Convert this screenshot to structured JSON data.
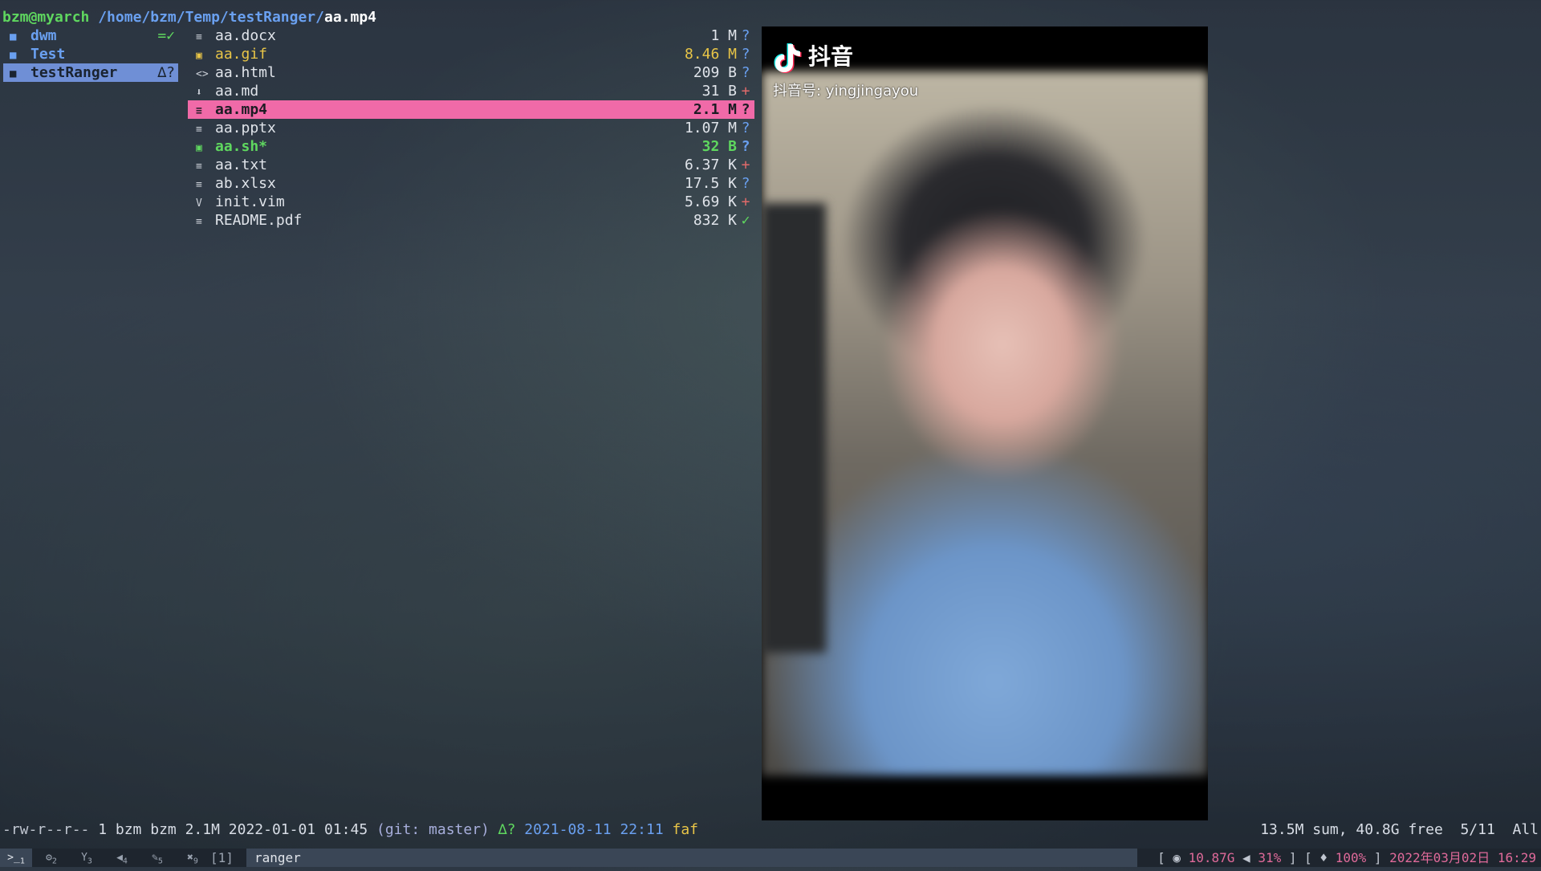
{
  "title": {
    "user": "bzm@myarch",
    "path": "/home/bzm/Temp/testRanger/",
    "file": "aa.mp4"
  },
  "parent": [
    {
      "name": "dwm",
      "tag": "=✓"
    },
    {
      "name": "Test",
      "tag": ""
    },
    {
      "name": "testRanger",
      "tag": "∆?"
    }
  ],
  "files": [
    {
      "icon": "doc-icon",
      "glyph": "≡",
      "name": "aa.docx",
      "size": "1 M",
      "status": "?"
    },
    {
      "icon": "image-icon",
      "glyph": "▣",
      "name": "aa.gif",
      "size": "8.46 M",
      "status": "?"
    },
    {
      "icon": "code-icon",
      "glyph": "<>",
      "name": "aa.html",
      "size": "209 B",
      "status": "?"
    },
    {
      "icon": "markdown-icon",
      "glyph": "⬇",
      "name": "aa.md",
      "size": "31 B",
      "status": "+"
    },
    {
      "icon": "doc-icon",
      "glyph": "≡",
      "name": "aa.mp4",
      "size": "2.1 M",
      "status": "?"
    },
    {
      "icon": "doc-icon",
      "glyph": "≡",
      "name": "aa.pptx",
      "size": "1.07 M",
      "status": "?"
    },
    {
      "icon": "terminal-icon",
      "glyph": "▣",
      "name": "aa.sh*",
      "size": "32 B",
      "status": "?"
    },
    {
      "icon": "doc-icon",
      "glyph": "≡",
      "name": "aa.txt",
      "size": "6.37 K",
      "status": "+"
    },
    {
      "icon": "doc-icon",
      "glyph": "≡",
      "name": "ab.xlsx",
      "size": "17.5 K",
      "status": "?"
    },
    {
      "icon": "vim-icon",
      "glyph": "V",
      "name": "init.vim",
      "size": "5.69 K",
      "status": "+"
    },
    {
      "icon": "doc-icon",
      "glyph": "≡",
      "name": "README.pdf",
      "size": "832 K",
      "status": "✓"
    }
  ],
  "preview": {
    "brand": "抖音",
    "handle": "抖音号: yingjingayou"
  },
  "statusline": {
    "perm": "-rw-r--r--",
    "info": " 1 bzm bzm 2.1M 2022-01-01 01:45 ",
    "git": "(git: master)",
    "mark": "∆?",
    "date": "2021-08-11 22:11",
    "user": "faf",
    "right": "13.5M sum, 40.8G free  5/11  All"
  },
  "bar": {
    "tags": [
      "1",
      "2",
      "3",
      "4",
      "5",
      "9"
    ],
    "layout": "[1]",
    "window_title": "ranger",
    "disk": "10.87G",
    "volume": "31%",
    "battery": "100%",
    "datetime": "2022年03月02日 16:29"
  },
  "colors": {
    "selected_file": "#f06aa8",
    "selected_dir": "#6f8fd6",
    "accent_green": "#5fd75f",
    "accent_blue": "#6aa0f0"
  }
}
